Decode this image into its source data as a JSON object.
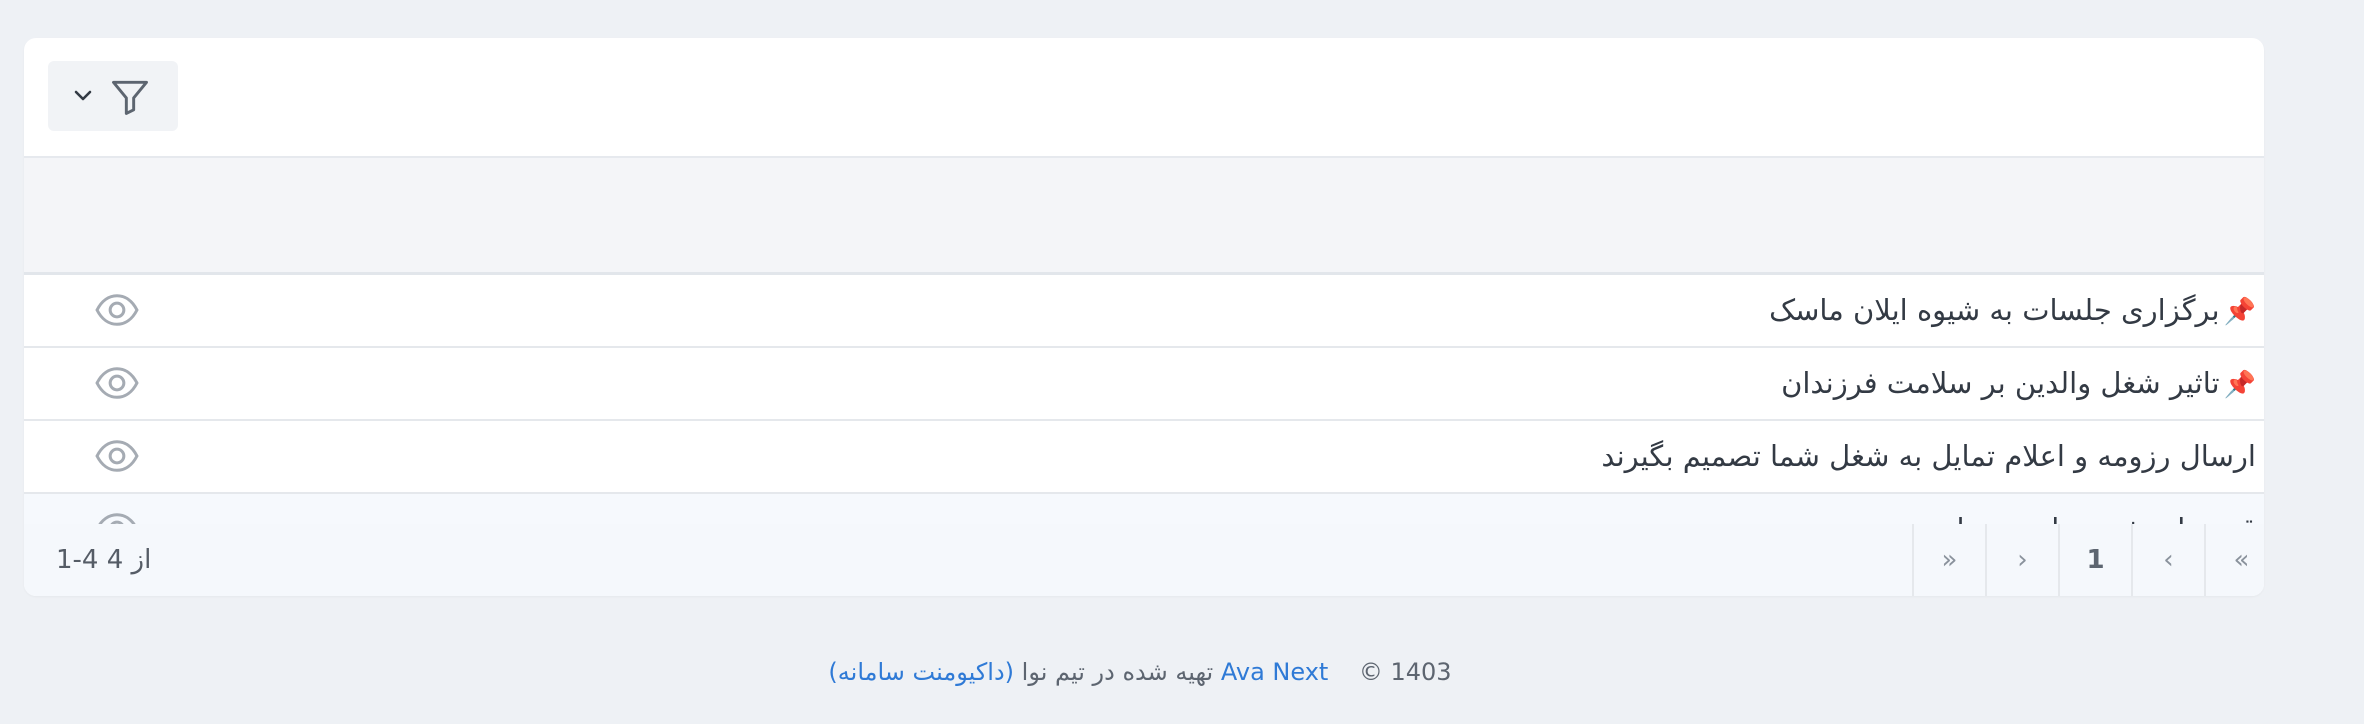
{
  "toolbar": {
    "filter_icon": "funnel-icon",
    "dropdown_icon": "chevron-down-icon"
  },
  "rows": [
    {
      "title": "برگزاری جلسات به شیوه ایلان ماسک",
      "pinned": true,
      "pin_icon": "📌",
      "action_icon": "eye-icon"
    },
    {
      "title": "تاثیر شغل والدین بر سلامت فرزندان",
      "pinned": true,
      "pin_icon": "📌",
      "action_icon": "eye-icon"
    },
    {
      "title": "ارسال رزومه و اعلام تمایل به شغل شما تصمیم بگیرند",
      "pinned": false,
      "action_icon": "eye-icon"
    },
    {
      "title": "قصه‌های شب برای مدیران",
      "pinned": false,
      "action_icon": "eye-icon"
    }
  ],
  "pagination": {
    "range_text": "1-4 از 4",
    "first": "«",
    "prev": "‹",
    "page": "1",
    "next": "›",
    "last": "»"
  },
  "footer": {
    "year": "© 1403",
    "brand": "Ava Next",
    "made_by": "تهیه شده در تیم نوا",
    "docs_link": "(داکیومنت سامانه)"
  },
  "colors": {
    "background": "#eef1f5",
    "card": "#ffffff",
    "link": "#2f7ad6",
    "pin": "#d9342b"
  }
}
